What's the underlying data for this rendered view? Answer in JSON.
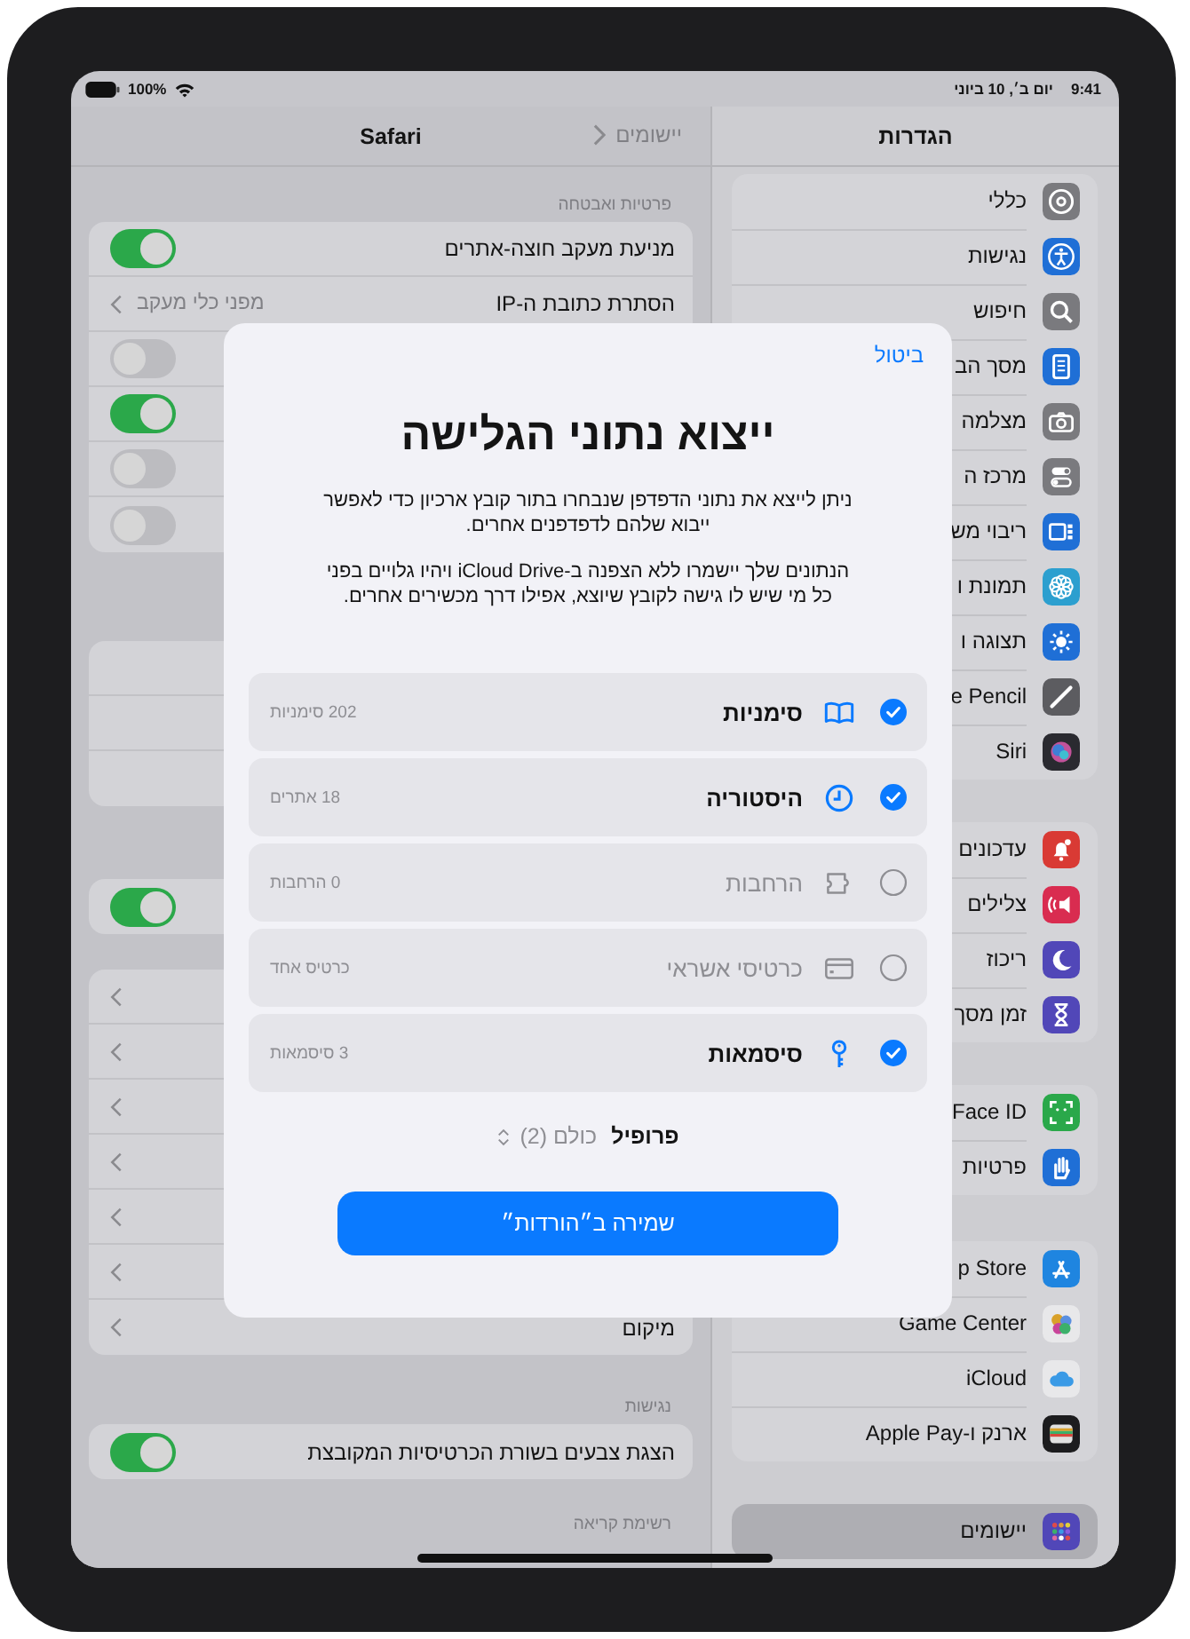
{
  "status_bar": {
    "time": "9:41",
    "date": "יום ב׳, 10 ביוני",
    "battery": "100%"
  },
  "detail": {
    "back": "יישומים",
    "title": "Safari",
    "sections": [
      {
        "header": "פרטיות ואבטחה",
        "rows": [
          {
            "kind": "toggle",
            "label": "מניעת מעקב חוצה-אתרים",
            "on": true
          },
          {
            "kind": "link",
            "label": "הסתרת כתובת ה-IP",
            "value": "מפני כלי מעקב"
          },
          {
            "kind": "toggle",
            "on": false
          },
          {
            "kind": "toggle",
            "on": true
          },
          {
            "kind": "toggle",
            "on": false
          },
          {
            "kind": "toggle",
            "on": false
          }
        ]
      },
      {
        "rows": [
          {
            "kind": "blank"
          },
          {
            "kind": "blank"
          },
          {
            "kind": "blank"
          }
        ]
      },
      {
        "rows": [
          {
            "kind": "toggle",
            "on": true
          }
        ]
      },
      {
        "rows": [
          {
            "kind": "link"
          },
          {
            "kind": "link"
          },
          {
            "kind": "link"
          },
          {
            "kind": "link"
          },
          {
            "kind": "link"
          },
          {
            "kind": "link"
          },
          {
            "kind": "link",
            "label": "מיקום"
          }
        ]
      },
      {
        "header": "נגישות",
        "rows": [
          {
            "kind": "toggle",
            "label": "הצגת צבעים בשורת הכרטיסיות המקובצת",
            "on": true
          }
        ]
      },
      {
        "header": "רשימת קריאה"
      }
    ]
  },
  "sidebar": {
    "title": "הגדרות",
    "groups": [
      {
        "items": [
          {
            "label": "כללי",
            "color": "#7a7a7e",
            "selected": false
          },
          {
            "label": "נגישות",
            "color": "#1f6fd6",
            "selected": false
          },
          {
            "label": "חיפוש",
            "color": "#7a7a7e",
            "selected": false
          },
          {
            "label": "מסך הב",
            "color": "#1f6fd6",
            "selected": false
          },
          {
            "label": "מצלמה",
            "color": "#7a7a7e",
            "selected": false
          },
          {
            "label": "מרכז ה",
            "color": "#7a7a7e",
            "selected": false
          },
          {
            "label": "ריבוי מש",
            "color": "#1f6fd6",
            "selected": false
          },
          {
            "label": "תמונת ו",
            "color": "#2c9fcf",
            "selected": false
          },
          {
            "label": "תצוגה ו",
            "color": "#1f6fd6",
            "selected": false
          },
          {
            "label": "e Pencil",
            "color": "#5c5c60",
            "selected": false
          },
          {
            "label": "Siri",
            "color": "#2a2a30",
            "selected": false
          }
        ]
      },
      {
        "items": [
          {
            "label": "עדכונים",
            "color": "#d93a34",
            "selected": false
          },
          {
            "label": "צלילים",
            "color": "#d92c50",
            "selected": false
          },
          {
            "label": "ריכוז",
            "color": "#5147b8",
            "selected": false
          },
          {
            "label": "זמן מסך",
            "color": "#5147b8",
            "selected": false
          }
        ]
      },
      {
        "items": [
          {
            "label": "Face ID",
            "color": "#2aa84a",
            "selected": false
          },
          {
            "label": "פרטיות",
            "color": "#1f6fd6",
            "selected": false
          }
        ]
      },
      {
        "items": [
          {
            "label": "p Store",
            "color": "#1f85e0",
            "selected": false
          },
          {
            "label": "Game Center",
            "color": "#e8e8ea",
            "selected": false
          },
          {
            "label": "iCloud",
            "color": "#e8e8ea",
            "selected": false
          },
          {
            "label": "ארנק ו-Apple Pay",
            "color": "#1c1c1e",
            "selected": false
          }
        ]
      },
      {
        "items": [
          {
            "label": "יישומים",
            "color": "#5147b8",
            "selected": true
          }
        ]
      }
    ]
  },
  "dialog": {
    "cancel": "ביטול",
    "title": "ייצוא נתוני הגלישה",
    "paragraphs": [
      "ניתן לייצא את נתוני הדפדפן שנבחרו בתור קובץ ארכיון כדי לאפשר ייבוא שלהם לדפדפנים אחרים.",
      "הנתונים שלך יישמרו ללא הצפנה ב-iCloud Drive ויהיו גלויים בפני כל מי שיש לו גישה לקובץ שיוצא, אפילו דרך מכשירים אחרים."
    ],
    "options": [
      {
        "label": "סימניות",
        "count": "202 סימניות",
        "checked": true
      },
      {
        "label": "היסטוריה",
        "count": "18 אתרים",
        "checked": true
      },
      {
        "label": "הרחבות",
        "count": "0 הרחבות",
        "checked": false
      },
      {
        "label": "כרטיסי אשראי",
        "count": "כרטיס אחד",
        "checked": false
      },
      {
        "label": "סיסמאות",
        "count": "3 סיסמאות",
        "checked": true
      }
    ],
    "profile": {
      "label": "פרופיל",
      "value": "כולם (2)"
    },
    "save": "שמירה ב״הורדות״"
  }
}
